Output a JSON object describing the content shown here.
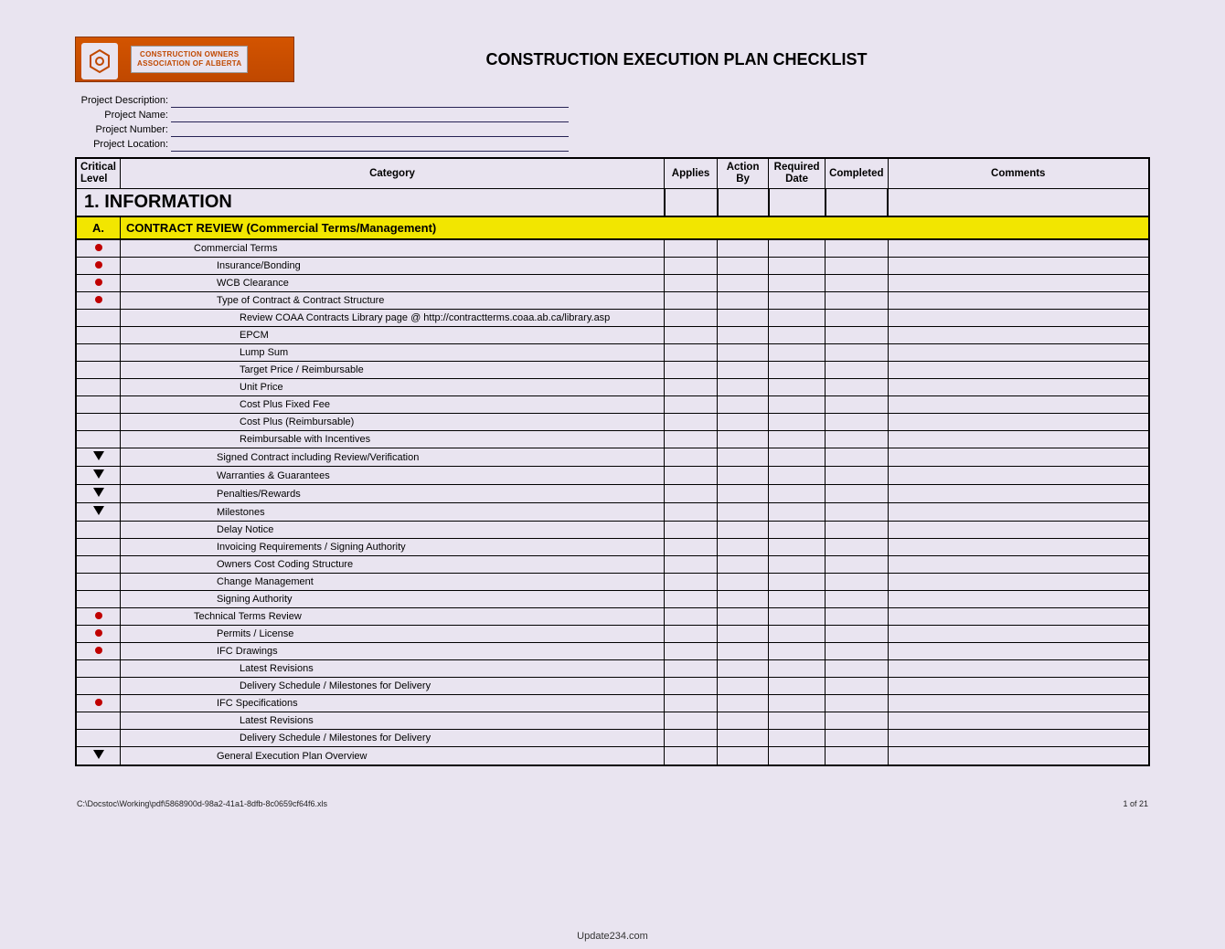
{
  "title": "CONSTRUCTION EXECUTION PLAN CHECKLIST",
  "logo": {
    "line1": "CONSTRUCTION OWNERS",
    "line2": "ASSOCIATION OF ALBERTA"
  },
  "meta": {
    "fields": [
      {
        "label": "Project Description:"
      },
      {
        "label": "Project Name:"
      },
      {
        "label": "Project Number:"
      },
      {
        "label": "Project Location:"
      }
    ]
  },
  "columns": {
    "critical": "Critical Level",
    "category": "Category",
    "applies": "Applies",
    "action_by": "Action By",
    "required_date": "Required Date",
    "completed": "Completed",
    "comments": "Comments"
  },
  "section": {
    "number_title": "1. INFORMATION"
  },
  "subsection": {
    "letter": "A.",
    "title": "CONTRACT REVIEW (Commercial Terms/Management)"
  },
  "rows": [
    {
      "crit": "red",
      "indent": 1,
      "text": "Commercial Terms"
    },
    {
      "crit": "red",
      "indent": 2,
      "text": "Insurance/Bonding"
    },
    {
      "crit": "red",
      "indent": 2,
      "text": "WCB Clearance"
    },
    {
      "crit": "red",
      "indent": 2,
      "text": "Type of Contract & Contract Structure"
    },
    {
      "crit": "",
      "indent": 3,
      "text": "Review COAA Contracts Library page @ http://contractterms.coaa.ab.ca/library.asp"
    },
    {
      "crit": "",
      "indent": 3,
      "text": "EPCM"
    },
    {
      "crit": "",
      "indent": 3,
      "text": "Lump Sum"
    },
    {
      "crit": "",
      "indent": 3,
      "text": "Target Price / Reimbursable"
    },
    {
      "crit": "",
      "indent": 3,
      "text": "Unit Price"
    },
    {
      "crit": "",
      "indent": 3,
      "text": "Cost Plus Fixed Fee"
    },
    {
      "crit": "",
      "indent": 3,
      "text": "Cost Plus (Reimbursable)"
    },
    {
      "crit": "",
      "indent": 3,
      "text": "Reimbursable with Incentives"
    },
    {
      "crit": "tri",
      "indent": 2,
      "text": "Signed Contract including Review/Verification"
    },
    {
      "crit": "tri",
      "indent": 2,
      "text": "Warranties & Guarantees"
    },
    {
      "crit": "tri",
      "indent": 2,
      "text": "Penalties/Rewards"
    },
    {
      "crit": "tri",
      "indent": 2,
      "text": "Milestones"
    },
    {
      "crit": "",
      "indent": 2,
      "text": "Delay Notice"
    },
    {
      "crit": "",
      "indent": 2,
      "text": "Invoicing Requirements / Signing Authority"
    },
    {
      "crit": "",
      "indent": 2,
      "text": "Owners Cost Coding Structure"
    },
    {
      "crit": "",
      "indent": 2,
      "text": "Change Management"
    },
    {
      "crit": "",
      "indent": 2,
      "text": "Signing Authority"
    },
    {
      "crit": "red",
      "indent": 1,
      "text": "Technical Terms Review"
    },
    {
      "crit": "red",
      "indent": 2,
      "text": "Permits / License"
    },
    {
      "crit": "red",
      "indent": 2,
      "text": "IFC Drawings"
    },
    {
      "crit": "",
      "indent": 3,
      "text": "Latest Revisions"
    },
    {
      "crit": "",
      "indent": 3,
      "text": "Delivery Schedule / Milestones for Delivery"
    },
    {
      "crit": "red",
      "indent": 2,
      "text": "IFC Specifications"
    },
    {
      "crit": "",
      "indent": 3,
      "text": "Latest Revisions"
    },
    {
      "crit": "",
      "indent": 3,
      "text": "Delivery Schedule / Milestones for Delivery"
    },
    {
      "crit": "tri",
      "indent": 2,
      "text": "General Execution Plan Overview"
    }
  ],
  "footer": {
    "path": "C:\\Docstoc\\Working\\pdf\\5868900d-98a2-41a1-8dfb-8c0659cf64f6.xls",
    "page": "1 of 21"
  },
  "attribution": "Update234.com"
}
